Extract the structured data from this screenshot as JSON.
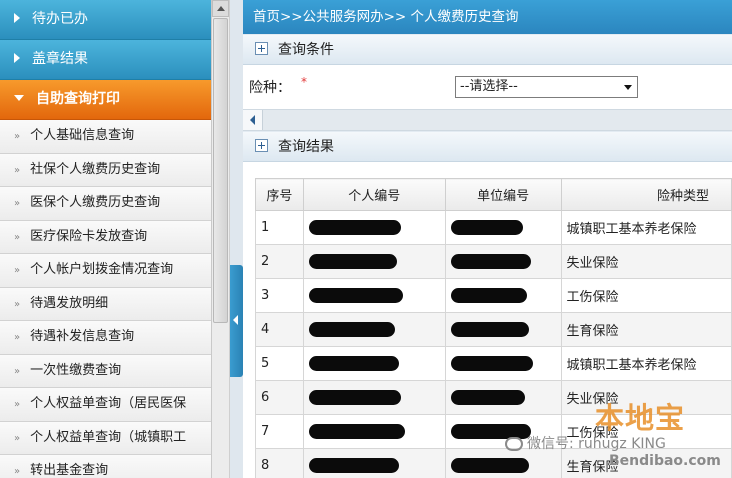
{
  "sidebar": {
    "headers": [
      "待办已办",
      "盖章结果",
      "自助查询打印"
    ],
    "items": [
      "个人基础信息查询",
      "社保个人缴费历史查询",
      "医保个人缴费历史查询",
      "医疗保险卡发放查询",
      "个人帐户划拨金情况查询",
      "待遇发放明细",
      "待遇补发信息查询",
      "一次性缴费查询",
      "个人权益单查询（居民医保",
      "个人权益单查询（城镇职工",
      "转出基金查询"
    ]
  },
  "breadcrumb": "首页>>公共服务网办>> 个人缴费历史查询",
  "query": {
    "section_title": "查询条件",
    "insurance_label": "险种：",
    "required_mark": "*",
    "insurance_select": "--请选择--"
  },
  "results": {
    "section_title": "查询结果",
    "columns": [
      "序号",
      "个人编号",
      "单位编号",
      "险种类型"
    ],
    "rows": [
      {
        "no": "1",
        "type": "城镇职工基本养老保险"
      },
      {
        "no": "2",
        "type": "失业保险"
      },
      {
        "no": "3",
        "type": "工伤保险"
      },
      {
        "no": "4",
        "type": "生育保险"
      },
      {
        "no": "5",
        "type": "城镇职工基本养老保险"
      },
      {
        "no": "6",
        "type": "失业保险"
      },
      {
        "no": "7",
        "type": "工伤保险"
      },
      {
        "no": "8",
        "type": "生育保险"
      }
    ]
  },
  "watermark": {
    "logo": "本地宝",
    "wechat": "微信号: ruhugz KING",
    "site": "Bendibao.com"
  }
}
